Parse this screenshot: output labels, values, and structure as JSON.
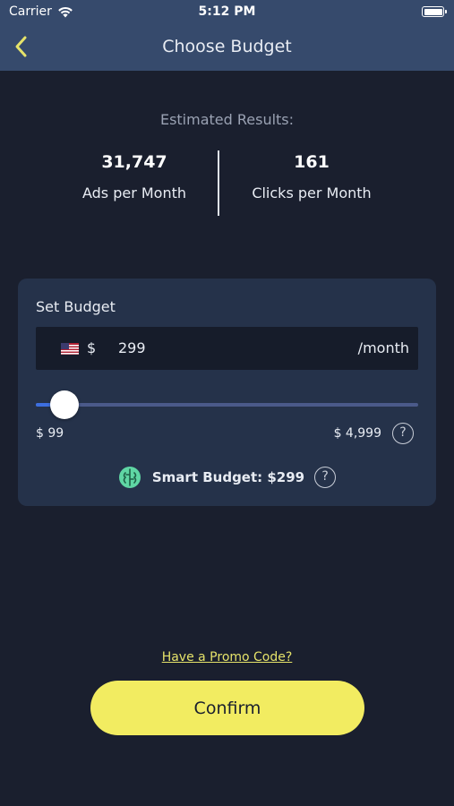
{
  "status_bar": {
    "carrier": "Carrier",
    "time": "5:12 PM"
  },
  "nav": {
    "title": "Choose Budget",
    "back_icon": "chevron-left-icon"
  },
  "results": {
    "label": "Estimated Results:",
    "ads": {
      "value": "31,747",
      "caption": "Ads per Month"
    },
    "clicks": {
      "value": "161",
      "caption": "Clicks per Month"
    }
  },
  "budget": {
    "title": "Set Budget",
    "currency_symbol": "$",
    "amount": "299",
    "period": "/month",
    "slider": {
      "min_label": "$ 99",
      "max_label": "$ 4,999",
      "min": 99,
      "max": 4999,
      "value": 299
    },
    "smart_budget": "Smart Budget: $299"
  },
  "help_glyph": "?",
  "promo_link": "Have a Promo Code?",
  "confirm_label": "Confirm",
  "colors": {
    "accent": "#f2ec61",
    "background": "#1a1f2e",
    "card": "#25324a",
    "header": "#364a6c",
    "slider_fill": "#3d6fe0"
  }
}
